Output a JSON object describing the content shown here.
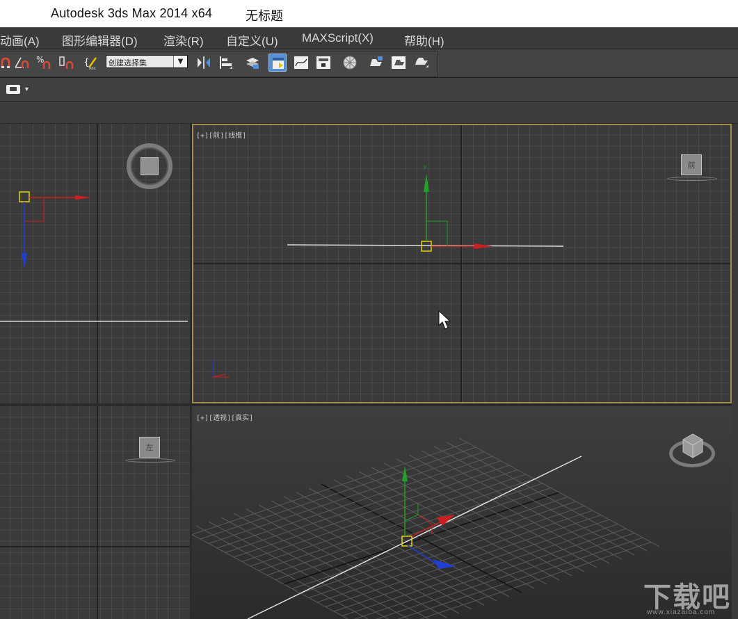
{
  "window": {
    "app_title": "Autodesk 3ds Max  2014 x64",
    "document_title": "无标题"
  },
  "menu": {
    "items": [
      "动画(A)",
      "图形编辑器(D)",
      "渲染(R)",
      "自定义(U)",
      "MAXScript(X)",
      "帮助(H)"
    ]
  },
  "toolbar": {
    "selection_set_placeholder": "创建选择集",
    "buttons": [
      "snap-toggle-icon",
      "angle-snap-icon",
      "percent-snap-icon",
      "spinner-snap-icon",
      "edit-named-selection-icon",
      "mirror-icon",
      "align-icon",
      "layer-manager-icon",
      "scene-explorer-icon",
      "curve-editor-icon",
      "schematic-view-icon",
      "material-editor-icon",
      "render-setup-icon",
      "rendered-frame-icon",
      "render-icon"
    ]
  },
  "viewports": {
    "top_left": {
      "label": ""
    },
    "front": {
      "label": "[+][前][线框]",
      "view_cube": "前"
    },
    "bottom_left": {
      "label": "",
      "view_cube": "左"
    },
    "perspective": {
      "label": "[+][透视][真实]"
    }
  },
  "axes": {
    "x": "x",
    "y": "y",
    "z": "z"
  },
  "colors": {
    "viewport_bg": "#3a3a3a",
    "grid_line": "#555555",
    "active_border": "#a38c48",
    "x_axis": "#cc1f1f",
    "y_axis": "#1fa12a",
    "z_axis": "#1f3fd0",
    "gizmo_box": "#e5d300"
  },
  "watermark": {
    "text": "下载吧",
    "url": "www.xiazaiba.com"
  }
}
